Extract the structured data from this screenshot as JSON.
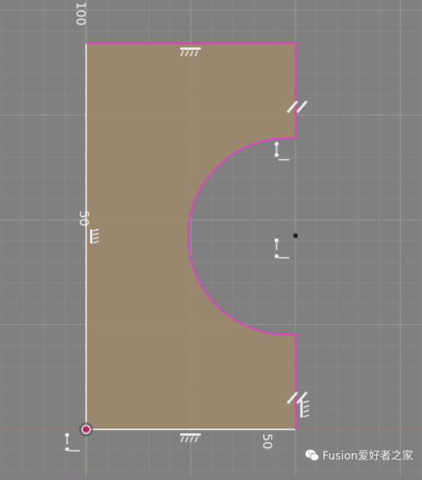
{
  "canvas": {
    "background_color": "#808080",
    "grid_minor_color": "#888888",
    "grid_major_color": "#9a9a9a",
    "axis_x_color": "#c87070",
    "axis_y_color": "#7ac77a"
  },
  "sketch": {
    "profile_fill_color": "#9d8a6b",
    "profile_edge_color": "#e040c8",
    "fixed_edge_color": "#e6e6e6",
    "constraint_color": "#f0f0f0",
    "origin_point_color": "#c0206a"
  },
  "dimensions": {
    "top_axis_value": "100",
    "height_value": "50",
    "width_value": "50"
  },
  "constraint_icons": [
    "horizontal-constraint-icon",
    "vertical-constraint-icon",
    "parallel-constraint-icon",
    "coincident-constraint-icon",
    "arc-center-point-icon"
  ],
  "watermark": {
    "text": "Fusion爱好者之家",
    "icon": "wechat-icon"
  }
}
